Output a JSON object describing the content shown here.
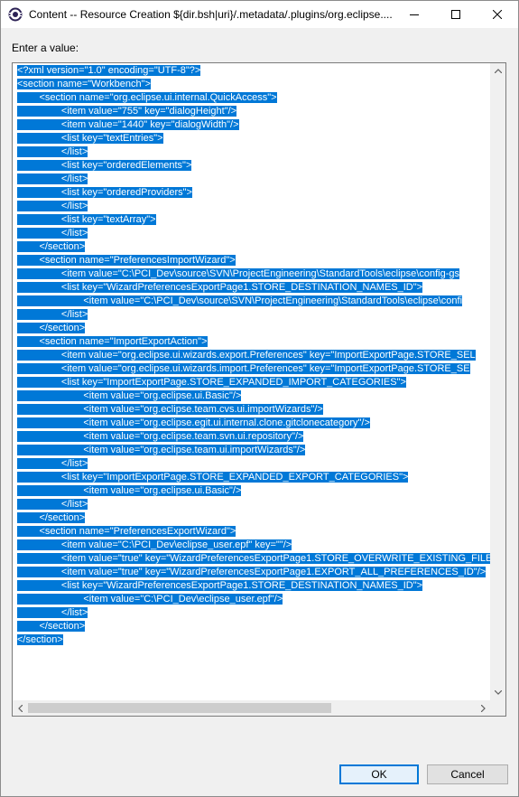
{
  "window": {
    "title": "Content -- Resource Creation ${dir.bsh|uri}/.metadata/.plugins/org.eclipse...."
  },
  "dialog": {
    "prompt": "Enter a value:",
    "ok_label": "OK",
    "cancel_label": "Cancel"
  },
  "editor": {
    "lines": [
      "<?xml version=\"1.0\" encoding=\"UTF-8\"?>",
      "<section name=\"Workbench\">",
      "        <section name=\"org.eclipse.ui.internal.QuickAccess\">",
      "                <item value=\"755\" key=\"dialogHeight\"/>",
      "                <item value=\"1440\" key=\"dialogWidth\"/>",
      "                <list key=\"textEntries\">",
      "                </list>",
      "                <list key=\"orderedElements\">",
      "                </list>",
      "                <list key=\"orderedProviders\">",
      "                </list>",
      "                <list key=\"textArray\">",
      "                </list>",
      "        </section>",
      "        <section name=\"PreferencesImportWizard\">",
      "                <item value=\"C:\\PCI_Dev\\source\\SVN\\ProjectEngineering\\StandardTools\\eclipse\\config-gs",
      "                <list key=\"WizardPreferencesExportPage1.STORE_DESTINATION_NAMES_ID\">",
      "                        <item value=\"C:\\PCI_Dev\\source\\SVN\\ProjectEngineering\\StandardTools\\eclipse\\confi",
      "                </list>",
      "        </section>",
      "        <section name=\"ImportExportAction\">",
      "                <item value=\"org.eclipse.ui.wizards.export.Preferences\" key=\"ImportExportPage.STORE_SEL",
      "                <item value=\"org.eclipse.ui.wizards.import.Preferences\" key=\"ImportExportPage.STORE_SE",
      "                <list key=\"ImportExportPage.STORE_EXPANDED_IMPORT_CATEGORIES\">",
      "                        <item value=\"org.eclipse.ui.Basic\"/>",
      "                        <item value=\"org.eclipse.team.cvs.ui.importWizards\"/>",
      "                        <item value=\"org.eclipse.egit.ui.internal.clone.gitclonecategory\"/>",
      "                        <item value=\"org.eclipse.team.svn.ui.repository\"/>",
      "                        <item value=\"org.eclipse.team.ui.importWizards\"/>",
      "                </list>",
      "                <list key=\"ImportExportPage.STORE_EXPANDED_EXPORT_CATEGORIES\">",
      "                        <item value=\"org.eclipse.ui.Basic\"/>",
      "                </list>",
      "        </section>",
      "        <section name=\"PreferencesExportWizard\">",
      "                <item value=\"C:\\PCI_Dev\\eclipse_user.epf\" key=\"\"/>",
      "                <item value=\"true\" key=\"WizardPreferencesExportPage1.STORE_OVERWRITE_EXISTING_FILE",
      "                <item value=\"true\" key=\"WizardPreferencesExportPage1.EXPORT_ALL_PREFERENCES_ID\"/>",
      "                <list key=\"WizardPreferencesExportPage1.STORE_DESTINATION_NAMES_ID\">",
      "                        <item value=\"C:\\PCI_Dev\\eclipse_user.epf\"/>",
      "                </list>",
      "        </section>",
      "</section>"
    ]
  }
}
